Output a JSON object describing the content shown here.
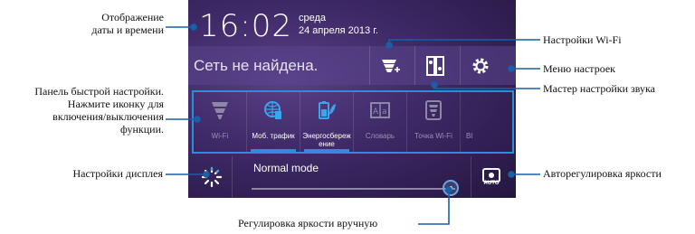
{
  "callouts": {
    "datetime": [
      "Отображение",
      "даты и времени"
    ],
    "quick_panel": [
      "Панель быстрой настройки.",
      "Нажмите иконку для",
      "включения/выключения",
      "функции."
    ],
    "display": "Настройки дисплея",
    "manual_brightness": "Регулировка яркости вручную",
    "wifi_settings": "Настройки Wi-Fi",
    "settings_menu": "Меню настроек",
    "sound_wizard": "Мастер настройки звука",
    "auto_brightness": "Авторегулировка яркости"
  },
  "panel": {
    "time": "16:02",
    "day": "среда",
    "date": "24 апреля 2013 г.",
    "network_status": "Сеть не найдена.",
    "tiles": [
      {
        "icon": "wifi-icon",
        "label": "Wi-Fi",
        "active": false
      },
      {
        "icon": "mobile-data-icon",
        "label": "Моб. трафик",
        "active": true
      },
      {
        "icon": "power-saver-icon",
        "label": "Энергосбереж ение",
        "active": true
      },
      {
        "icon": "dictionary-icon",
        "label": "Словарь",
        "active": false
      },
      {
        "icon": "hotspot-icon",
        "label": "Точка Wi-Fi",
        "active": false
      },
      {
        "icon": "bluetooth-icon",
        "label": "Bl",
        "active": false
      }
    ],
    "brightness_mode": "Normal mode",
    "brightness_level": 0.95,
    "auto_label": "AUTO"
  },
  "colors": {
    "accent": "#2a8fd6",
    "panel_bg": "#3d2966"
  }
}
